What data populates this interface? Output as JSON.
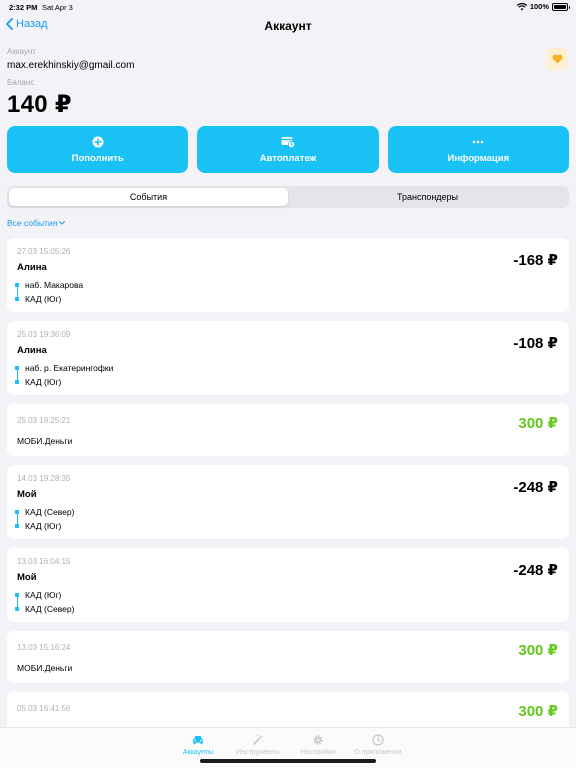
{
  "status_bar": {
    "time": "2:32 PM",
    "date": "Sat Apr 3",
    "battery": "100%"
  },
  "nav": {
    "back_label": "Назад",
    "title": "Аккаунт"
  },
  "account": {
    "account_label": "Аккаунт",
    "email": "max.erekhinskiy@gmail.com",
    "balance_label": "Баланс",
    "balance": "140 ₽"
  },
  "actions": [
    {
      "label": "Пополнить",
      "icon": "plus-circle-icon"
    },
    {
      "label": "Автоплатеж",
      "icon": "autopay-icon"
    },
    {
      "label": "Информация",
      "icon": "ellipsis-icon"
    }
  ],
  "segments": [
    {
      "label": "События",
      "active": true
    },
    {
      "label": "Транспондеры",
      "active": false
    }
  ],
  "filter": {
    "label": "Все события"
  },
  "events": [
    {
      "kind": "trip",
      "timestamp": "27.03 15:05:26",
      "title": "Алина",
      "from": "наб. Макарова",
      "to": "КАД (Юг)",
      "amount": "-168 ₽"
    },
    {
      "kind": "trip",
      "timestamp": "25.03 19:36:09",
      "title": "Алина",
      "from": "наб. р. Екатерингофки",
      "to": "КАД (Юг)",
      "amount": "-108 ₽"
    },
    {
      "kind": "topup",
      "timestamp": "25.03 19:25:21",
      "note": "МОБИ.Деньги",
      "amount": "300 ₽"
    },
    {
      "kind": "trip",
      "timestamp": "14.03 19:28:35",
      "title": "Мой",
      "from": "КАД (Север)",
      "to": "КАД (Юг)",
      "amount": "-248 ₽"
    },
    {
      "kind": "trip",
      "timestamp": "13.03 16:04:15",
      "title": "Мой",
      "from": "КАД (Юг)",
      "to": "КАД (Север)",
      "amount": "-248 ₽"
    },
    {
      "kind": "topup",
      "timestamp": "13.03 15:16:24",
      "note": "МОБИ.Деньги",
      "amount": "300 ₽"
    },
    {
      "kind": "topup",
      "timestamp": "05.03 16:41:56",
      "note": "",
      "amount": "300 ₽"
    }
  ],
  "tabs": [
    {
      "label": "Аккаунты",
      "icon": "car-icon",
      "active": true
    },
    {
      "label": "Инструменты",
      "icon": "magic-wand-icon",
      "active": false
    },
    {
      "label": "Настройки",
      "icon": "gear-icon",
      "active": false
    },
    {
      "label": "О приложении",
      "icon": "clock-icon",
      "active": false
    }
  ],
  "colors": {
    "accent": "#1ac1f5",
    "link": "#1a9bf0",
    "positive": "#62c91c",
    "favorite": "#f5b21c"
  }
}
